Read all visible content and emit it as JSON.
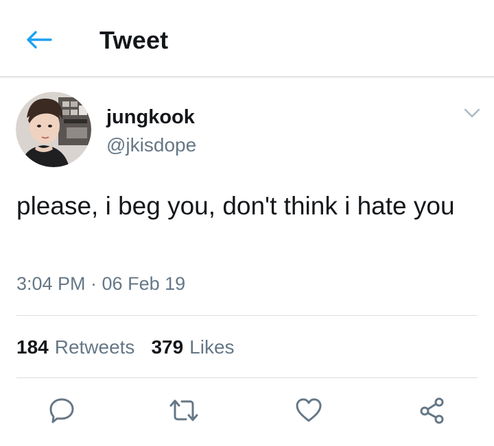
{
  "header": {
    "title": "Tweet",
    "back_icon": "arrow-left-icon"
  },
  "author": {
    "display_name": "jungkook",
    "handle": "@jkisdope",
    "avatar": "profile-photo"
  },
  "tweet": {
    "text": "please, i beg you, don't think i hate you",
    "timestamp": "3:04 PM · 06 Feb 19"
  },
  "stats": {
    "retweets_count": "184",
    "retweets_label": "Retweets",
    "likes_count": "379",
    "likes_label": "Likes"
  },
  "actions": [
    "reply-icon",
    "retweet-icon",
    "like-icon",
    "share-icon"
  ],
  "colors": {
    "accent": "#1da1f2",
    "text_primary": "#14171a",
    "text_secondary": "#657786",
    "divider": "#d8dde1",
    "icon": "#657786"
  }
}
